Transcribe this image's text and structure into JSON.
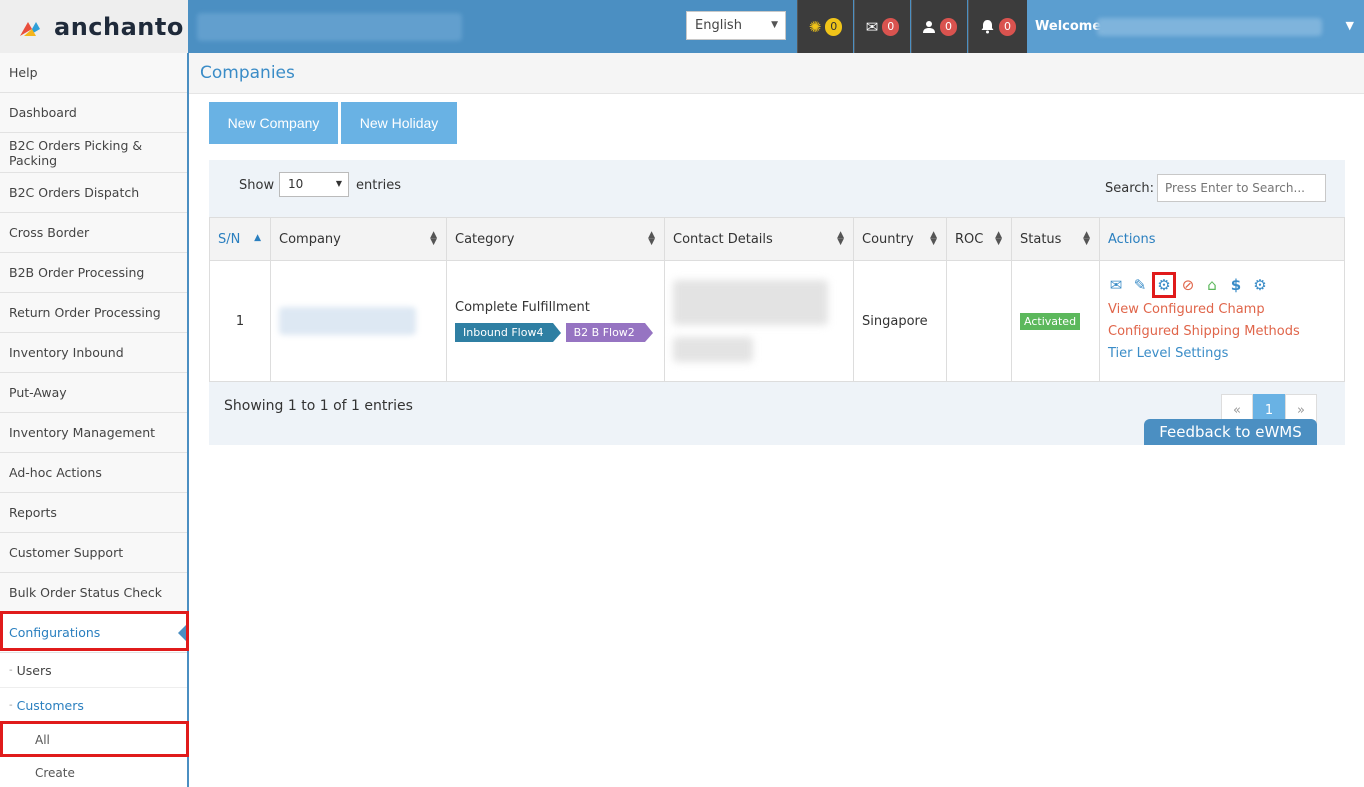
{
  "app": {
    "logo_text": "anchanto",
    "language": "English",
    "welcome": "Welcome,"
  },
  "notifications": [
    {
      "icon": "spinner-icon",
      "glyph": "✺",
      "count": "0",
      "color": "#f0c419"
    },
    {
      "icon": "envelope-icon",
      "glyph": "✉",
      "count": "0",
      "color": "#d9534f"
    },
    {
      "icon": "user-icon",
      "glyph": "👤",
      "count": "0",
      "color": "#d9534f"
    },
    {
      "icon": "bell-icon",
      "glyph": "🔔",
      "count": "0",
      "color": "#d9534f"
    }
  ],
  "sidebar": {
    "items": [
      "Help",
      "Dashboard",
      "B2C Orders Picking & Packing",
      "B2C Orders Dispatch",
      "Cross Border",
      "B2B Order Processing",
      "Return Order Processing",
      "Inventory Inbound",
      "Put-Away",
      "Inventory Management",
      "Ad-hoc Actions",
      "Reports",
      "Customer Support",
      "Bulk Order Status Check",
      "Configurations"
    ],
    "sub_users": "Users",
    "sub_customers": "Customers",
    "sub_all": "All",
    "sub_create": "Create"
  },
  "page": {
    "title": "Companies",
    "new_company": "New Company",
    "new_holiday": "New Holiday"
  },
  "table_controls": {
    "show": "Show",
    "entries_value": "10",
    "entries": "entries",
    "search_label": "Search:",
    "search_placeholder": "Press Enter to Search..."
  },
  "columns": {
    "sn": "S/N",
    "company": "Company",
    "category": "Category",
    "contact": "Contact Details",
    "country": "Country",
    "roc": "ROC",
    "status": "Status",
    "actions": "Actions"
  },
  "row": {
    "sn": "1",
    "category": "Complete Fulfillment",
    "tag1": "Inbound Flow4",
    "tag2": "B2 B Flow2",
    "country": "Singapore",
    "status": "Activated",
    "link1": "View Configured Champ",
    "link2": "Configured Shipping Methods",
    "link3": "Tier Level Settings"
  },
  "footer": {
    "showing": "Showing 1 to 1 of 1 entries",
    "prev": "«",
    "page": "1",
    "next": "»",
    "feedback": "Feedback to eWMS"
  },
  "colors": {
    "primary": "#4b8fc2",
    "button": "#69b2e4",
    "highlight": "#e01b1b",
    "activated": "#5cb85c"
  }
}
